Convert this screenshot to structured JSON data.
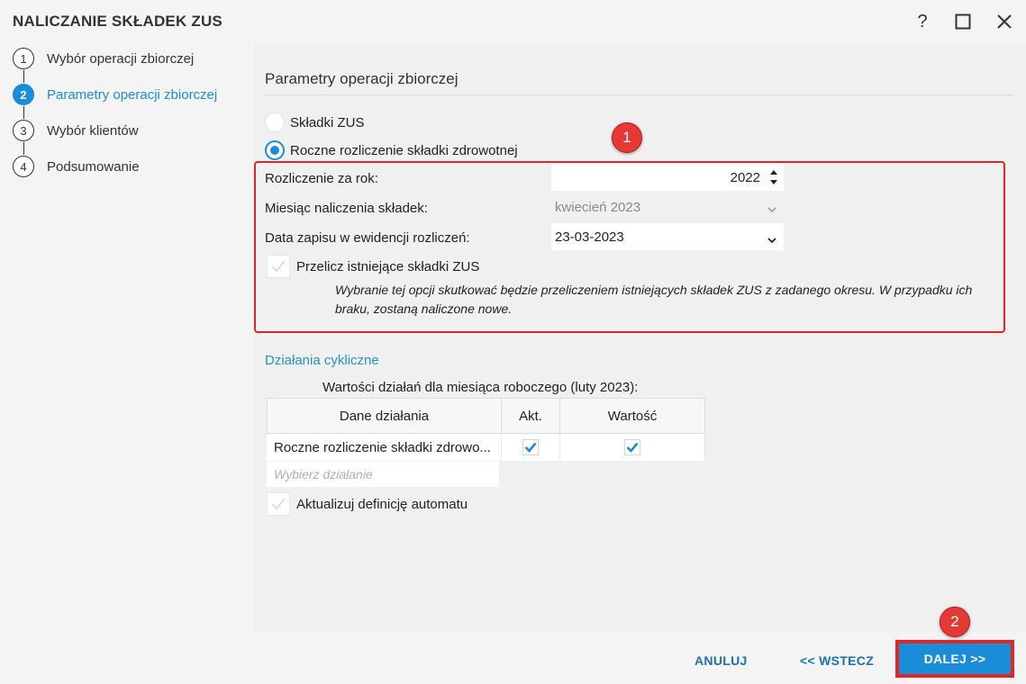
{
  "window": {
    "title": "NALICZANIE SKŁADEK ZUS",
    "help": "?",
    "maximize": "☐",
    "close": "✕"
  },
  "steps": [
    {
      "num": "1",
      "label": "Wybór operacji zbiorczej"
    },
    {
      "num": "2",
      "label": "Parametry operacji zbiorczej"
    },
    {
      "num": "3",
      "label": "Wybór klientów"
    },
    {
      "num": "4",
      "label": "Podsumowanie"
    }
  ],
  "main": {
    "section_title": "Parametry operacji zbiorczej",
    "radio_zus": "Składki ZUS",
    "radio_annual": "Roczne rozliczenie składki zdrowotnej",
    "fields": {
      "year_label": "Rozliczenie za rok:",
      "year_value": "2022",
      "month_label": "Miesiąc naliczenia składek:",
      "month_value": "kwiecień 2023",
      "date_label": "Data zapisu w ewidencji rozliczeń:",
      "date_value": "23-03-2023"
    },
    "recalc_label": "Przelicz istniejące składki ZUS",
    "note": "Wybranie tej opcji skutkować będzie przeliczeniem istniejących składek ZUS z zadanego okresu. W przypadku ich braku, zostaną naliczone nowe.",
    "cyclic": {
      "title": "Działania cykliczne",
      "subtitle": "Wartości działań dla miesiąca roboczego (luty 2023):",
      "headers": [
        "Dane działania",
        "Akt.",
        "Wartość"
      ],
      "rows": [
        {
          "name": "Roczne rozliczenie składki zdrowo..."
        }
      ],
      "picker_placeholder": "Wybierz działanie",
      "update_label": "Aktualizuj definicję automatu"
    }
  },
  "badges": {
    "one": "1",
    "two": "2"
  },
  "footer": {
    "cancel": "ANULUJ",
    "back": "<< WSTECZ",
    "next": "DALEJ >>"
  },
  "colors": {
    "accent": "#1a8cd8",
    "highlight": "#e02727"
  }
}
